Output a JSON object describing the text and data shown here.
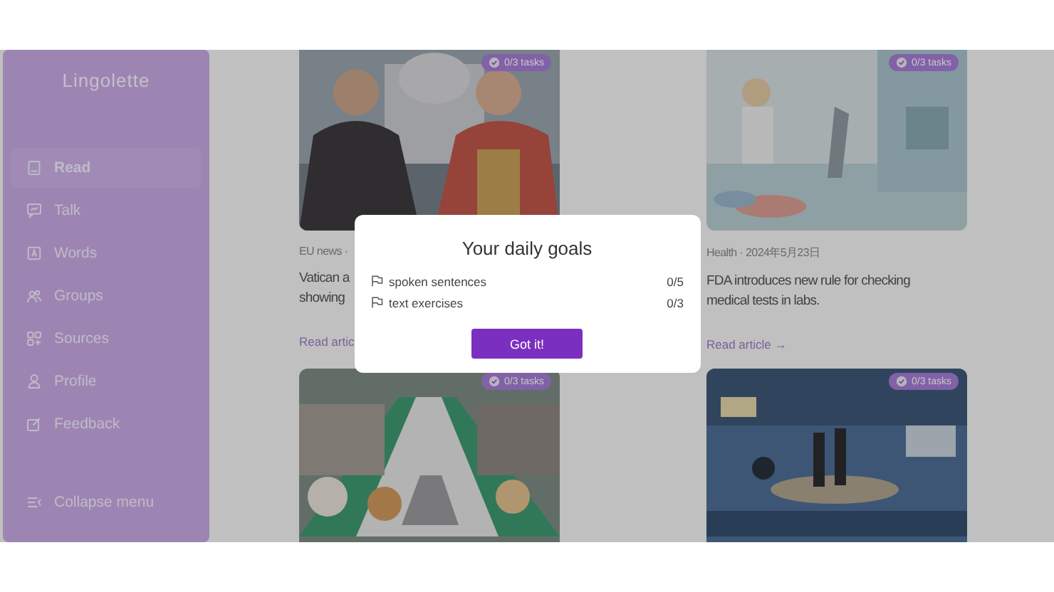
{
  "sidebar": {
    "logo": "Lingolette",
    "items": [
      {
        "label": "Read",
        "selected": true
      },
      {
        "label": "Talk",
        "selected": false
      },
      {
        "label": "Words",
        "selected": false
      },
      {
        "label": "Groups",
        "selected": false
      },
      {
        "label": "Sources",
        "selected": false
      },
      {
        "label": "Profile",
        "selected": false
      },
      {
        "label": "Feedback",
        "selected": false
      }
    ],
    "collapse": "Collapse menu"
  },
  "articles": [
    {
      "badge": "0/3 tasks",
      "meta": "EU news ·",
      "title_lines": [
        "Vatican a",
        "showing"
      ],
      "link": "Read artic"
    },
    {
      "badge": "0/3 tasks",
      "meta": "Health · 2024年5月23日",
      "title_lines": [
        "FDA introduces new rule for checking",
        "medical tests in labs."
      ],
      "link": "Read article →"
    },
    {
      "badge": "0/3 tasks"
    },
    {
      "badge": "0/3 tasks"
    }
  ],
  "modal": {
    "title": "Your daily goals",
    "goals": [
      {
        "label": "spoken sentences",
        "count": "0/5"
      },
      {
        "label": "text exercises",
        "count": "0/3"
      }
    ],
    "button": "Got it!"
  }
}
